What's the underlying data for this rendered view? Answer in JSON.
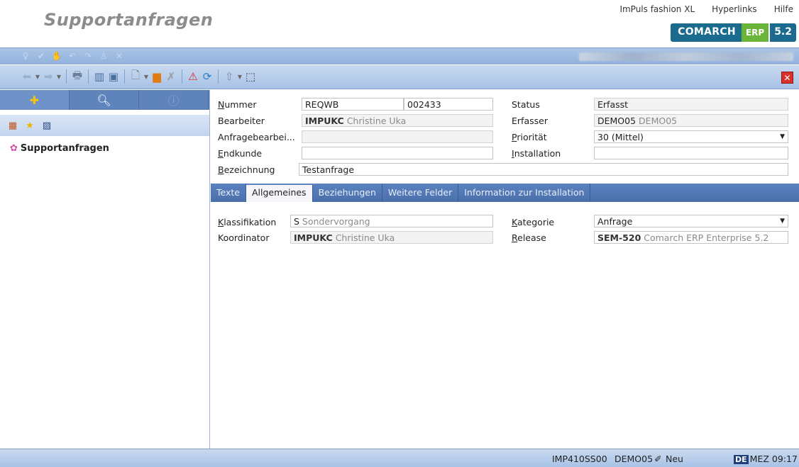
{
  "header": {
    "title": "Supportanfragen",
    "links": [
      "ImPuls fashion XL",
      "Hyperlinks",
      "Hilfe"
    ],
    "brand": {
      "name": "COMARCH",
      "erp": "ERP",
      "version": "5.2",
      "accent": "#1b6b8f",
      "green": "#6bb43a"
    }
  },
  "left_panel": {
    "tabs": [
      "navigation-icon",
      "search-icon",
      "info-icon"
    ],
    "tree_item": "Supportanfragen"
  },
  "form": {
    "nummer_label": "Nummer",
    "nummer_value": "REQWB",
    "nummer_value2": "002433",
    "status_label": "Status",
    "status_value": "Erfasst",
    "bearbeiter_label": "Bearbeiter",
    "bearbeiter_code": "IMPUKC",
    "bearbeiter_name": "Christine Uka",
    "erfasser_label": "Erfasser",
    "erfasser_code": "DEMO05",
    "erfasser_name": "DEMO05",
    "anfragebearbeiter_label": "Anfragebearbei...",
    "anfragebearbeiter_value": "",
    "prioritaet_label": "Priorität",
    "prioritaet_value": "30 (Mittel)",
    "endkunde_label": "Endkunde",
    "endkunde_value": "",
    "installation_label": "Installation",
    "installation_value": "",
    "bezeichnung_label": "Bezeichnung",
    "bezeichnung_value": "Testanfrage"
  },
  "tabs": [
    "Texte",
    "Allgemeines",
    "Beziehungen",
    "Weitere Felder",
    "Information zur Installation"
  ],
  "active_tab": "Allgemeines",
  "allgemeines": {
    "klassifikation_label": "Klassifikation",
    "klassifikation_code": "S",
    "klassifikation_name": "Sondervorgang",
    "kategorie_label": "Kategorie",
    "kategorie_value": "Anfrage",
    "koordinator_label": "Koordinator",
    "koordinator_code": "IMPUKC",
    "koordinator_name": "Christine Uka",
    "release_label": "Release",
    "release_code": "SEM-520",
    "release_name": "Comarch ERP Enterprise 5.2"
  },
  "statusbar": {
    "system": "IMP410SS00",
    "user": "DEMO05",
    "mode": "Neu",
    "lang": "DE",
    "time": "MEZ 09:17"
  }
}
